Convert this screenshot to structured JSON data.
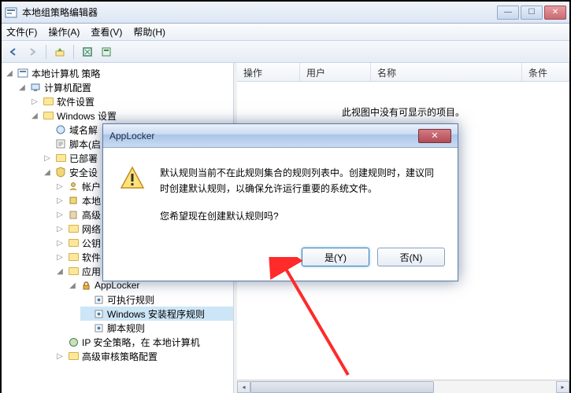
{
  "window": {
    "title": "本地组策略编辑器"
  },
  "menu": {
    "file": "文件(F)",
    "action": "操作(A)",
    "view": "查看(V)",
    "help": "帮助(H)"
  },
  "winctrl": {
    "min": "—",
    "max": "☐",
    "close": "✕"
  },
  "tree": {
    "root": "本地计算机 策略",
    "computer": "计算机配置",
    "software": "软件设置",
    "windows": "Windows 设置",
    "domain": "域名解",
    "script": "脚本(启",
    "deployed": "已部署",
    "security": "安全设",
    "accounts": "帐户",
    "local": "本地",
    "advanced": "高级",
    "network": "网络",
    "pubkey": "公钥",
    "soft2": "软件",
    "apprestrict": "应用",
    "applocker": "AppLocker",
    "exe": "可执行规则",
    "installer": "Windows 安装程序规则",
    "scriptr": "脚本规则",
    "ipsec": "IP 安全策略，在 本地计算机",
    "audit": "高级审核策略配置"
  },
  "list": {
    "cols": {
      "action": "操作",
      "user": "用户",
      "name": "名称",
      "cond": "条件"
    },
    "empty": "此视图中没有可显示的项目。"
  },
  "dialog": {
    "title": "AppLocker",
    "msg1": "默认规则当前不在此规则集合的规则列表中。创建规则时，建议同时创建默认规则，以确保允许运行重要的系统文件。",
    "msg2": "您希望现在创建默认规则吗?",
    "yes": "是(Y)",
    "no": "否(N)",
    "close": "✕"
  }
}
